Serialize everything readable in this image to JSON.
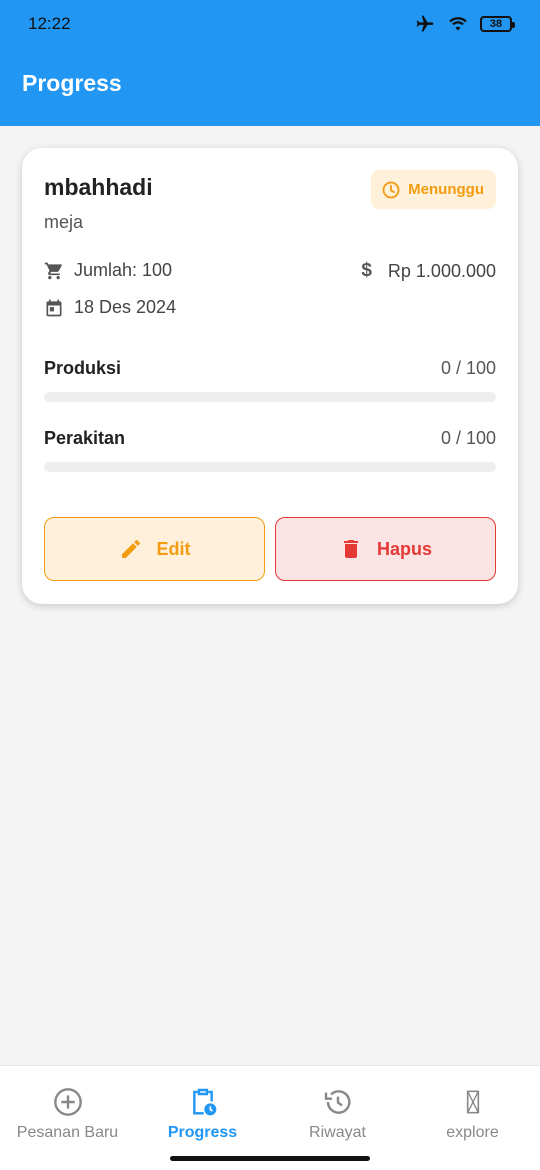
{
  "status_bar": {
    "time": "12:22",
    "battery": "38"
  },
  "appbar": {
    "title": "Progress"
  },
  "order": {
    "customer": "mbahhadi",
    "item": "meja",
    "status": "Menunggu",
    "quantity_label": "Jumlah: 100",
    "price": "Rp 1.000.000",
    "date": "18 Des 2024",
    "progress": [
      {
        "label": "Produksi",
        "value_text": "0 / 100",
        "fraction": 0
      },
      {
        "label": "Perakitan",
        "value_text": "0 / 100",
        "fraction": 0
      }
    ],
    "edit_label": "Edit",
    "delete_label": "Hapus"
  },
  "nav": {
    "items": [
      {
        "label": "Pesanan Baru",
        "icon": "add-circle-icon",
        "active": false
      },
      {
        "label": "Progress",
        "icon": "clipboard-clock-icon",
        "active": true
      },
      {
        "label": "Riwayat",
        "icon": "history-icon",
        "active": false
      },
      {
        "label": "explore",
        "icon": "missing-glyph-icon",
        "active": false
      }
    ]
  },
  "colors": {
    "primary": "#2196f3",
    "warning": "#f39c12",
    "danger": "#e53935"
  }
}
